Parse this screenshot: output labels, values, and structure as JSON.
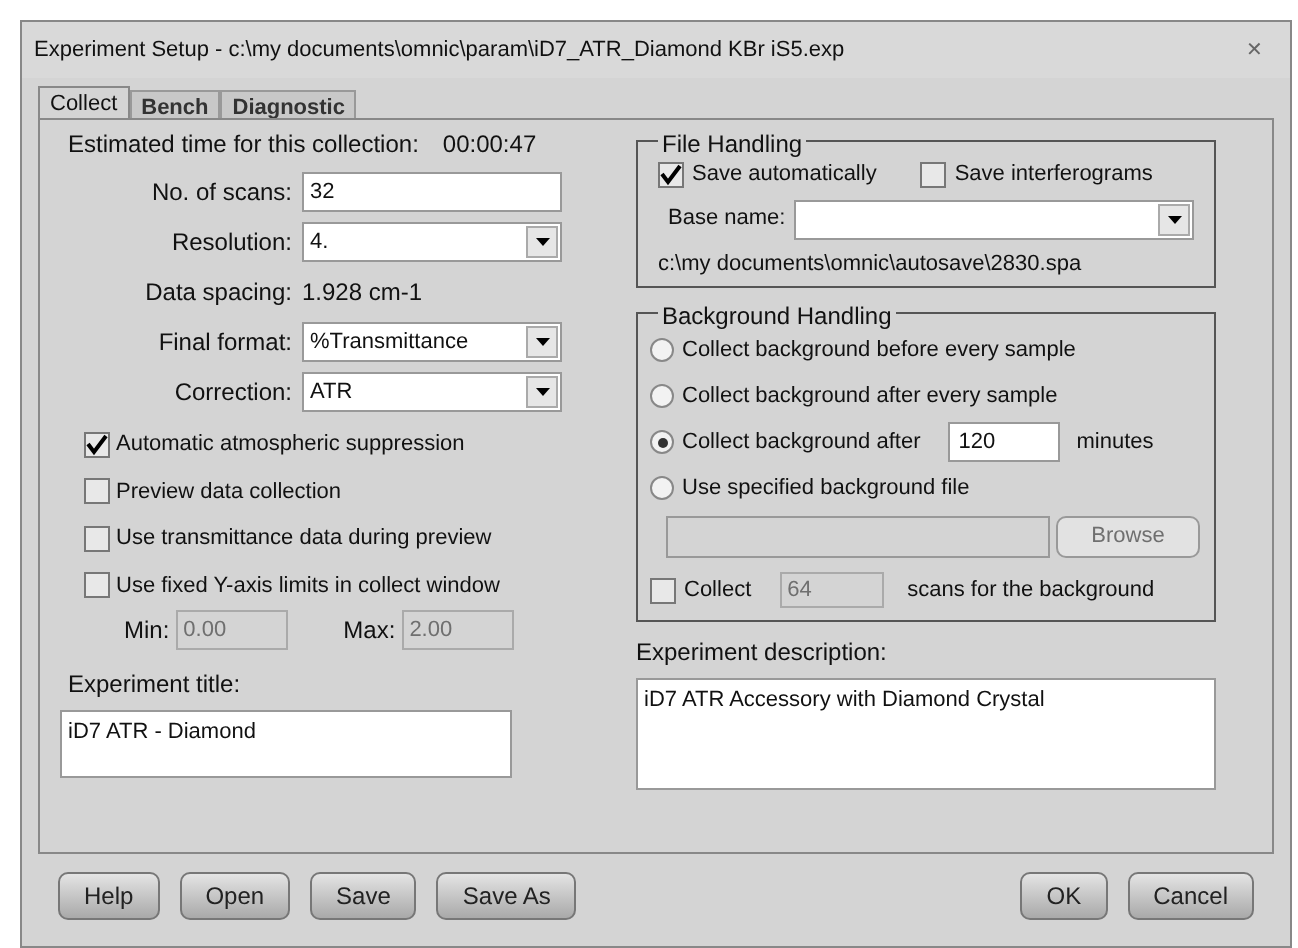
{
  "window": {
    "title": "Experiment Setup - c:\\my documents\\omnic\\param\\iD7_ATR_Diamond KBr iS5.exp",
    "close": "✕"
  },
  "tabs": [
    {
      "label": "Collect",
      "selected": true
    },
    {
      "label": "Bench",
      "selected": false
    },
    {
      "label": "Diagnostic",
      "selected": false
    }
  ],
  "estimated_time": {
    "label": "Estimated time for this collection:",
    "value": "00:00:47"
  },
  "fields": [
    {
      "kind": "input",
      "label": "No. of scans:",
      "value": "32"
    },
    {
      "kind": "select",
      "label": "Resolution:",
      "value": "4."
    },
    {
      "kind": "text",
      "label": "Data spacing:",
      "value": "1.928 cm-1"
    },
    {
      "kind": "select",
      "label": "Final format:",
      "value": "%Transmittance"
    },
    {
      "kind": "select",
      "label": "Correction:",
      "value": "ATR"
    }
  ],
  "options": [
    {
      "label": "Automatic atmospheric suppression",
      "checked": true
    },
    {
      "label": "Preview data collection",
      "checked": false
    },
    {
      "label": "Use transmittance data during preview",
      "checked": false
    },
    {
      "label": "Use fixed Y-axis limits in collect window",
      "checked": false
    }
  ],
  "y_limits": [
    {
      "label": "Min:",
      "value": "0.00"
    },
    {
      "label": "Max:",
      "value": "2.00"
    }
  ],
  "experiment_title": {
    "label": "Experiment title:",
    "value": "iD7 ATR - Diamond"
  },
  "file_handling": {
    "title": "File Handling",
    "save_automatically": {
      "label": "Save automatically",
      "checked": true
    },
    "save_interferograms": {
      "label": "Save interferograms",
      "checked": false
    },
    "base_name": {
      "label": "Base name:"
    },
    "path": "c:\\my documents\\omnic\\autosave\\2830.spa"
  },
  "background_handling": {
    "title": "Background Handling",
    "choices": [
      {
        "kind": "plain",
        "label": "Collect background before every sample",
        "selected": false
      },
      {
        "kind": "plain",
        "label": "Collect background after every sample",
        "selected": false
      },
      {
        "kind": "minutes",
        "label": "Collect background after",
        "value": "120",
        "unit": "minutes",
        "selected": true
      },
      {
        "kind": "file",
        "label": "Use specified background file",
        "selected": false
      }
    ],
    "browse": {
      "label": "Browse",
      "disabled": true
    },
    "collect": {
      "label": "Collect",
      "checked": false,
      "value": "64",
      "suffix": "scans for the background"
    }
  },
  "experiment_description": {
    "label": "Experiment description:",
    "value": "iD7 ATR Accessory with Diamond Crystal"
  },
  "buttons_left": [
    "Help",
    "Open",
    "Save",
    "Save As"
  ],
  "buttons_right": [
    "OK",
    "Cancel"
  ]
}
